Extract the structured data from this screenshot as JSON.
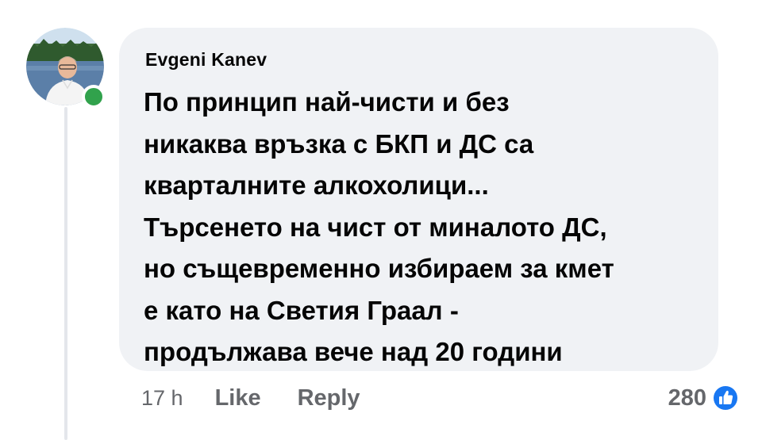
{
  "comment": {
    "author": "Evgeni Kanev",
    "text": "По принцип най-чисти и без\nникаква връзка с БКП и ДС са\nкварталните алкохолици...\nТърсенето на чист от миналото ДС,\nно същевременно избираем за кмет\nе като на Светия Граал -\nпродължава вече над 20 години",
    "online": true
  },
  "actions": {
    "time": "17 h",
    "like_label": "Like",
    "reply_label": "Reply"
  },
  "reactions": {
    "count": "280",
    "icon": "like-thumbs-up-icon",
    "color": "#1877f2"
  },
  "colors": {
    "bubble": "#f0f2f5",
    "online": "#31a24c",
    "muted_text": "#65676b",
    "text": "#050505"
  }
}
